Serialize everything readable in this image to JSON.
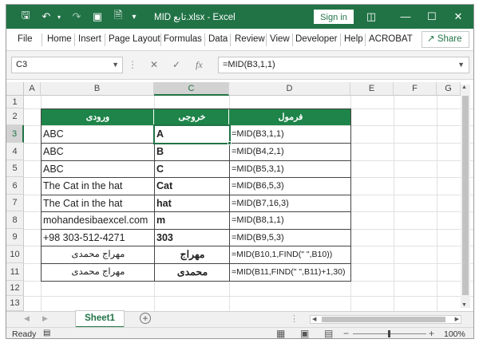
{
  "titlebar": {
    "title": "MID تابع.xlsx  -  Excel",
    "signin": "Sign in"
  },
  "menu": [
    "File",
    "Home",
    "Insert",
    "Page Layout",
    "Formulas",
    "Data",
    "Review",
    "View",
    "Developer",
    "Help",
    "ACROBAT"
  ],
  "share": "Share",
  "formula_bar": {
    "name_box": "C3",
    "fx": "fx",
    "formula": "=MID(B3,1,1)"
  },
  "columns": [
    "A",
    "B",
    "C",
    "D",
    "E",
    "F",
    "G"
  ],
  "rows": [
    "1",
    "2",
    "3",
    "4",
    "5",
    "6",
    "7",
    "8",
    "9",
    "10",
    "11",
    "12",
    "13"
  ],
  "table": {
    "headers": [
      "ورودی",
      "خروجی",
      "فرمول"
    ],
    "rows": [
      {
        "input": "ABC",
        "output": "A",
        "formula": "=MID(B3,1,1)"
      },
      {
        "input": "ABC",
        "output": "B",
        "formula": "=MID(B4,2,1)"
      },
      {
        "input": "ABC",
        "output": "C",
        "formula": "=MID(B5,3,1)"
      },
      {
        "input": "The Cat in the hat",
        "output": "Cat",
        "formula": "=MID(B6,5,3)"
      },
      {
        "input": "The Cat in the hat",
        "output": "hat",
        "formula": "=MID(B7,16,3)"
      },
      {
        "input": "mohandesibaexcel.com",
        "output": "m",
        "formula": "=MID(B8,1,1)"
      },
      {
        "input": "+98 303-512-4271",
        "output": "303",
        "formula": "=MID(B9,5,3)"
      },
      {
        "input": "مهراج محمدی",
        "output": "مهراج",
        "formula": "=MID(B10,1,FIND(\" \",B10))"
      },
      {
        "input": "مهراج محمدی",
        "output": "محمدی",
        "formula": "=MID(B11,FIND(\" \",B11)+1,30)"
      }
    ]
  },
  "sheet_tab": "Sheet1",
  "status": {
    "ready": "Ready",
    "zoom": "100%"
  }
}
